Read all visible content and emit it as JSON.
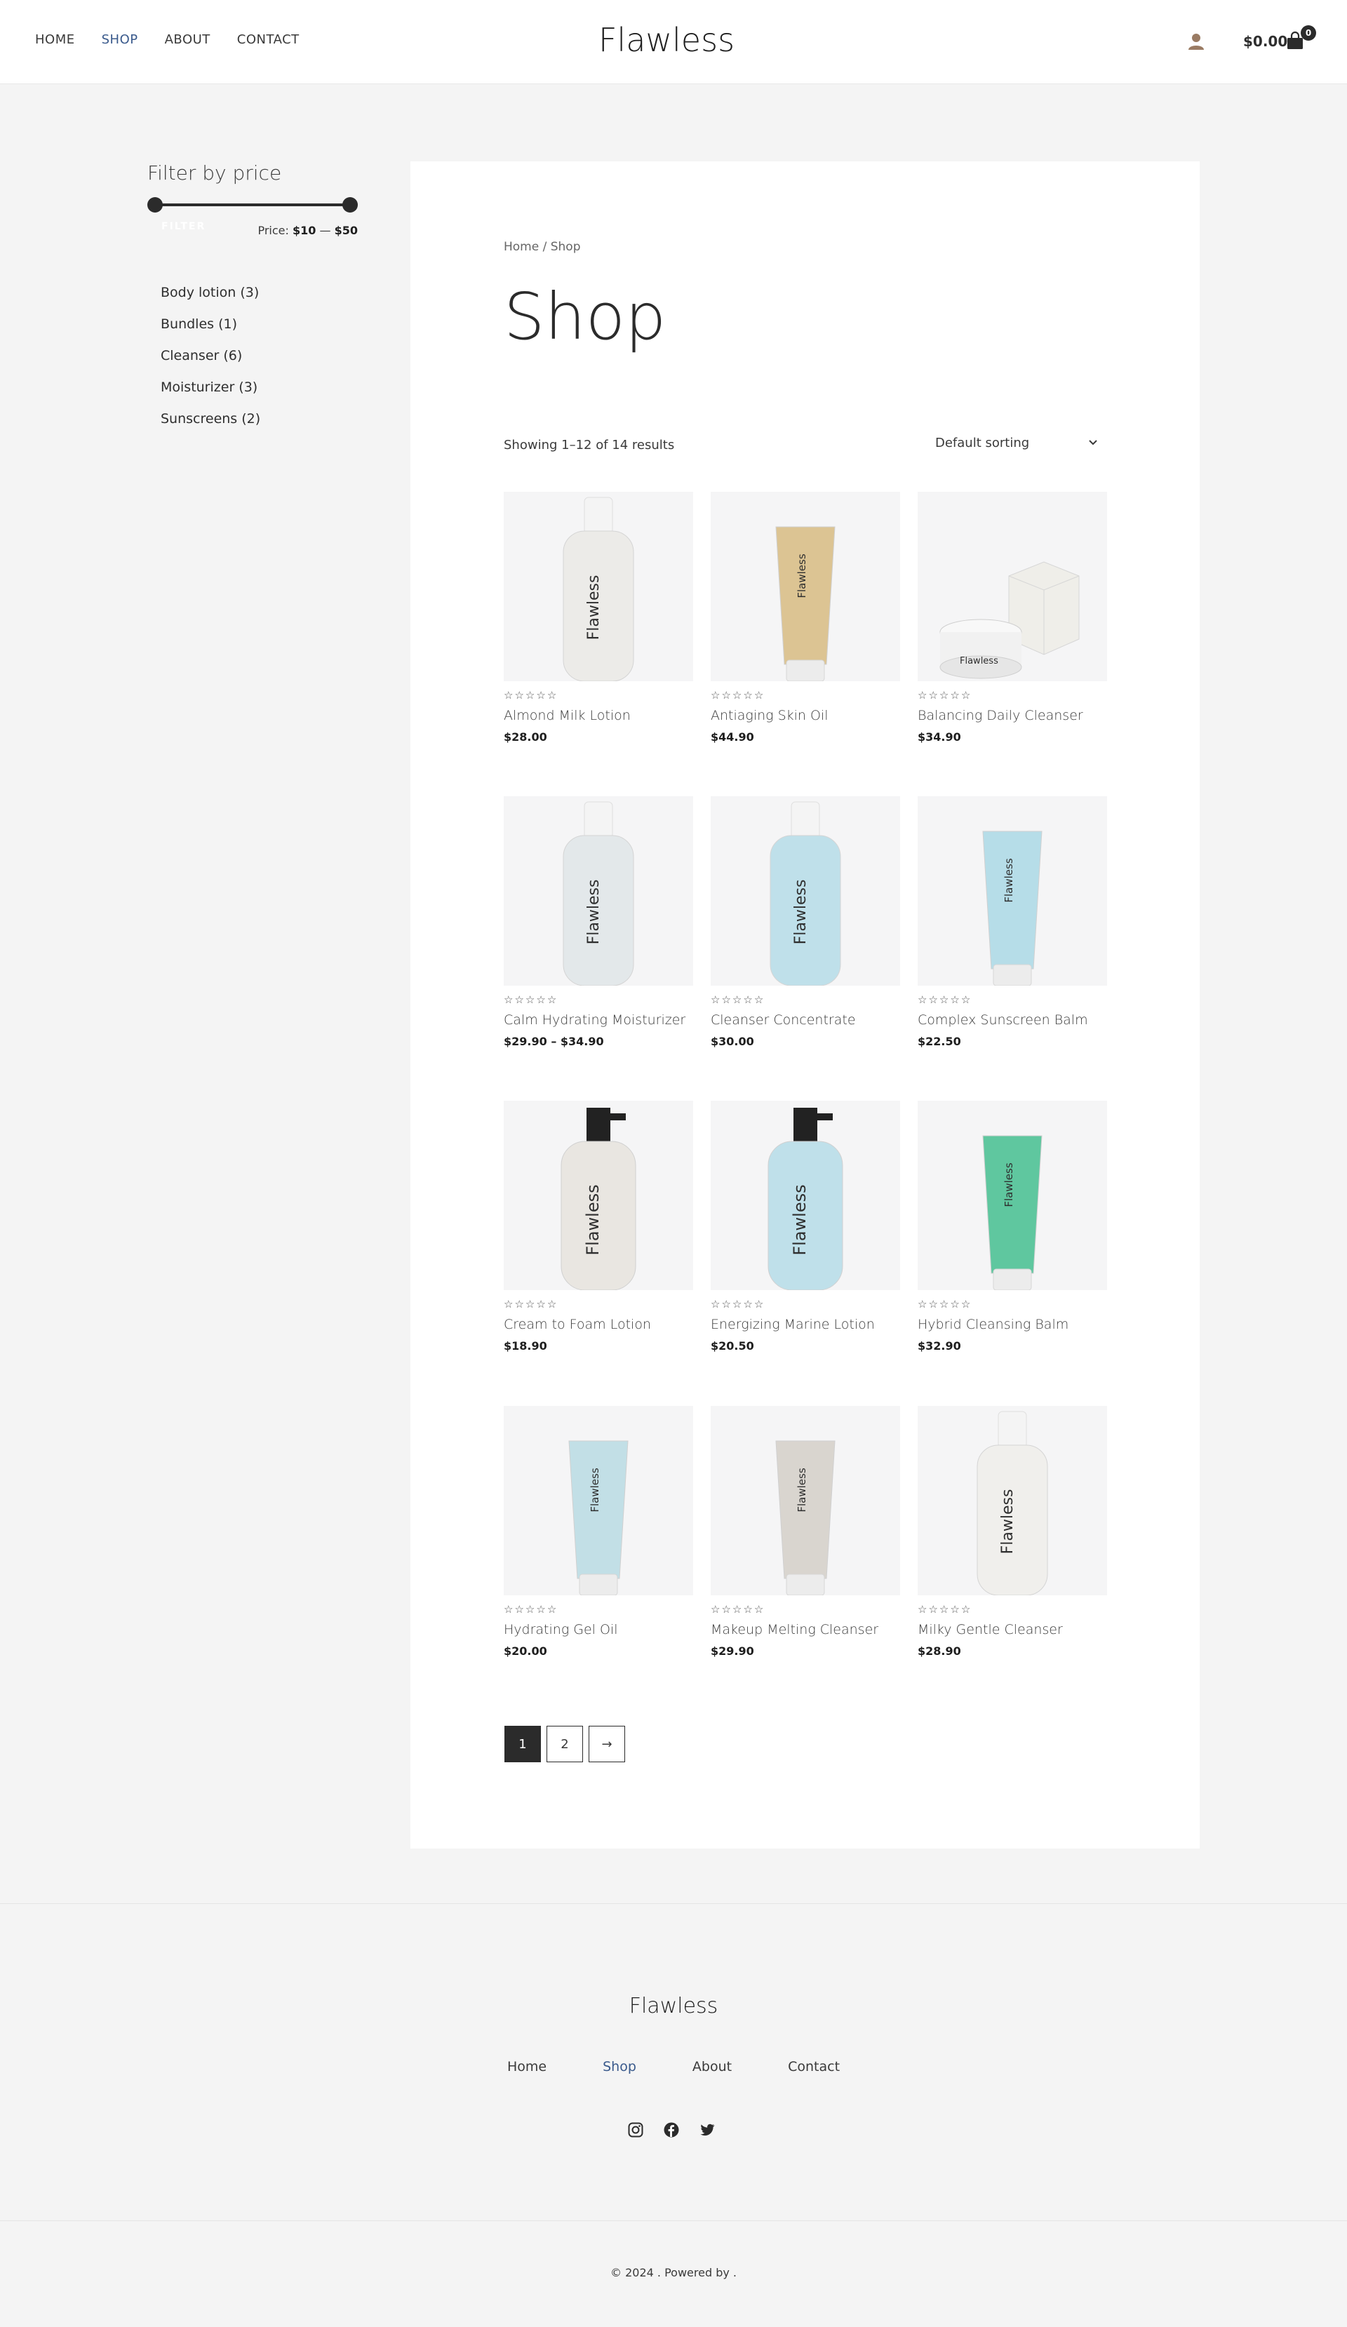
{
  "header": {
    "nav": [
      {
        "label": "HOME",
        "active": false
      },
      {
        "label": "SHOP",
        "active": true
      },
      {
        "label": "ABOUT",
        "active": false
      },
      {
        "label": "CONTACT",
        "active": false
      }
    ],
    "site_title": "Flawless",
    "cart_total": "$0.00",
    "cart_count": "0",
    "accent_color": "#3a5a8c"
  },
  "sidebar": {
    "filter_title": "Filter by price",
    "filter_button": "FILTER",
    "price_prefix": "Price:",
    "price_min": "$10",
    "price_sep": "—",
    "price_max": "$50",
    "categories": [
      "Body lotion (3)",
      "Bundles (1)",
      "Cleanser (6)",
      "Moisturizer (3)",
      "Sunscreens (2)"
    ]
  },
  "main": {
    "breadcrumb": "Home / Shop",
    "title": "Shop",
    "result_count": "Showing 1–12 of 14 results",
    "sort_label": "Default sorting",
    "products": [
      {
        "name": "Almond Milk Lotion",
        "price": "$28.00",
        "icon": "lotion-bottle",
        "color": "#ecebe8"
      },
      {
        "name": "Antiaging Skin Oil",
        "price": "$44.90",
        "icon": "tube",
        "color": "#dcc493"
      },
      {
        "name": "Balancing Daily Cleanser",
        "price": "$34.90",
        "icon": "jar-box",
        "color": "#efeee9"
      },
      {
        "name": "Calm Hydrating Moisturizer",
        "price": "$29.90 – $34.90",
        "icon": "lotion-bottle",
        "color": "#e3e8ea"
      },
      {
        "name": "Cleanser Concentrate",
        "price": "$30.00",
        "icon": "lotion-bottle",
        "color": "#bfe0ea"
      },
      {
        "name": "Complex Sunscreen Balm",
        "price": "$22.50",
        "icon": "tube",
        "color": "#b6dde8"
      },
      {
        "name": "Cream to Foam Lotion",
        "price": "$18.90",
        "icon": "pump-bottle",
        "color": "#e9e6e1"
      },
      {
        "name": "Energizing Marine Lotion",
        "price": "$20.50",
        "icon": "pump-bottle",
        "color": "#bfe0ea"
      },
      {
        "name": "Hybrid Cleansing Balm",
        "price": "$32.90",
        "icon": "tube",
        "color": "#5fc79f"
      },
      {
        "name": "Hydrating Gel Oil",
        "price": "$20.00",
        "icon": "tube",
        "color": "#c2dfe6"
      },
      {
        "name": "Makeup Melting Cleanser",
        "price": "$29.90",
        "icon": "tube",
        "color": "#d9d5cf"
      },
      {
        "name": "Milky Gentle Cleanser",
        "price": "$28.90",
        "icon": "lotion-bottle",
        "color": "#f0efec"
      }
    ],
    "pagination": [
      "1",
      "2",
      "→"
    ]
  },
  "footer": {
    "title": "Flawless",
    "nav": [
      {
        "label": "Home",
        "active": false
      },
      {
        "label": "Shop",
        "active": true
      },
      {
        "label": "About",
        "active": false
      },
      {
        "label": "Contact",
        "active": false
      }
    ],
    "social": [
      "instagram-icon",
      "facebook-icon",
      "twitter-icon"
    ],
    "copyright": "© 2024 . Powered by ."
  }
}
